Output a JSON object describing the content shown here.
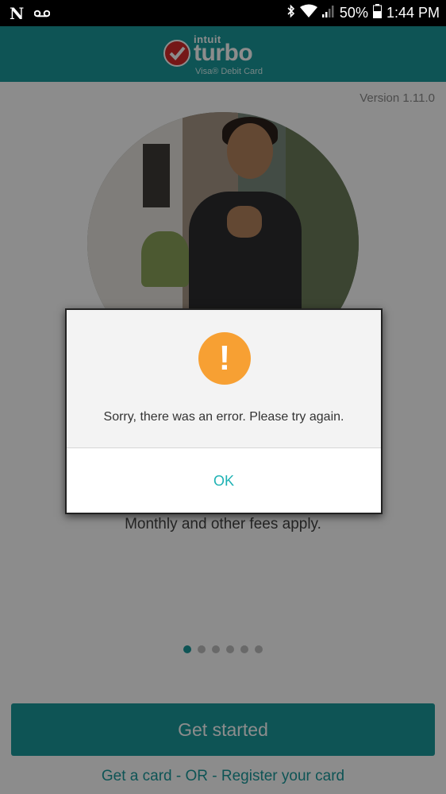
{
  "status_bar": {
    "left_icons": [
      "netflix-icon",
      "voicemail-icon"
    ],
    "right_icons": [
      "bluetooth-icon",
      "wifi-icon",
      "signal-icon",
      "battery-icon"
    ],
    "battery": "50%",
    "time": "1:44 PM",
    "netflix_glyph": "N"
  },
  "app_bar": {
    "logo_brand": "intuit",
    "logo_product": "turbo",
    "logo_subtitle": "Visa® Debit Card"
  },
  "version": "Version 1.11.0",
  "tagline": "Monthly and other fees apply.",
  "carousel": {
    "count": 6,
    "active_index": 0
  },
  "get_started_label": "Get started",
  "bottom_links": {
    "get_card": "Get a card",
    "separator": " - OR - ",
    "register": "Register your card"
  },
  "dialog": {
    "icon": "warning-icon",
    "icon_glyph": "!",
    "message": "Sorry, there was an error. Please try again.",
    "ok_label": "OK"
  },
  "colors": {
    "teal": "#1a9a9c",
    "warning": "#f7a033"
  }
}
